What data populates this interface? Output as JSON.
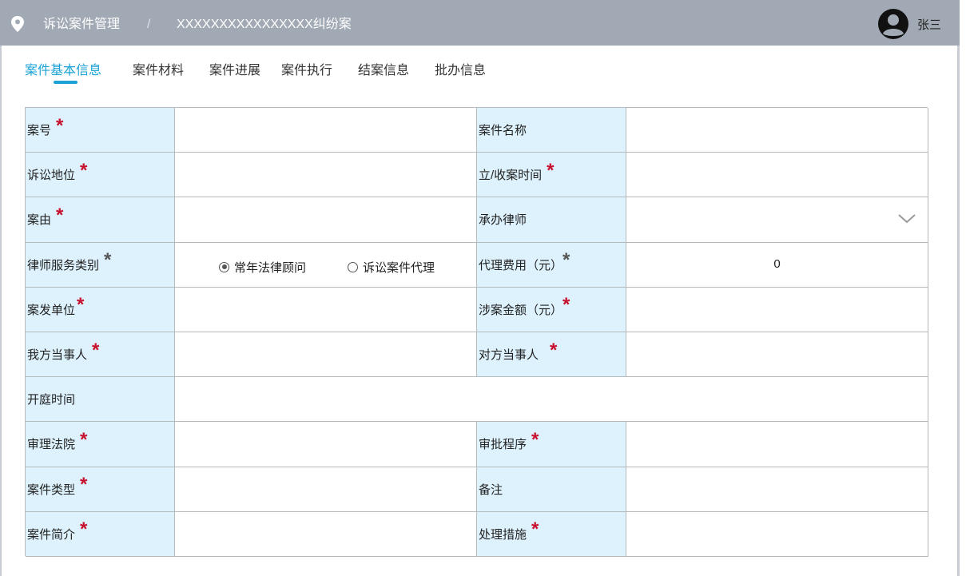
{
  "header": {
    "breadcrumb_root": "诉讼案件管理",
    "breadcrumb_sep": "/",
    "breadcrumb_case": "XXXXXXXXXXXXXXXX纠纷案",
    "user_name": "张三"
  },
  "tabs": [
    {
      "label": "案件基本信息",
      "active": true
    },
    {
      "label": "案件材料",
      "active": false
    },
    {
      "label": "案件进展",
      "active": false
    },
    {
      "label": "案件执行",
      "active": false
    },
    {
      "label": "结案信息",
      "active": false
    },
    {
      "label": "批办信息",
      "active": false
    }
  ],
  "form": {
    "case_no": {
      "label": "案号",
      "star": "*",
      "value": ""
    },
    "case_name": {
      "label": "案件名称",
      "value": ""
    },
    "litigation_status": {
      "label": "诉讼地位",
      "star": "*",
      "value": ""
    },
    "filing_time": {
      "label": "立/收案时间",
      "star": "*",
      "value": ""
    },
    "cause": {
      "label": "案由",
      "star": "*",
      "value": ""
    },
    "lawyer": {
      "label": "承办律师",
      "value": ""
    },
    "service_type": {
      "label": "律师服务类别",
      "star": "*",
      "options": [
        {
          "label": "常年法律顾问",
          "checked": true
        },
        {
          "label": "诉讼案件代理",
          "checked": false
        }
      ]
    },
    "agency_fee": {
      "label": "代理费用（元）",
      "star": "*",
      "value": "0"
    },
    "origin_unit": {
      "label": "案发单位",
      "star": "*",
      "value": ""
    },
    "amount_involved": {
      "label": "涉案金额（元）",
      "star": "*",
      "value": ""
    },
    "our_party": {
      "label": "我方当事人",
      "star": "*",
      "value": ""
    },
    "opposing_party": {
      "label": "对方当事人",
      "star": "*",
      "value": ""
    },
    "hearing_time": {
      "label": "开庭时间",
      "value": ""
    },
    "court": {
      "label": "审理法院",
      "star": "*",
      "value": ""
    },
    "approval_procedure": {
      "label": "审批程序",
      "star": "*",
      "value": ""
    },
    "case_type": {
      "label": "案件类型",
      "star": "*",
      "value": ""
    },
    "remark": {
      "label": "备注",
      "value": ""
    },
    "case_summary": {
      "label": "案件简介",
      "star": "*",
      "value": ""
    },
    "measures": {
      "label": "处理措施",
      "star": "*",
      "value": ""
    }
  },
  "colors": {
    "header_bg": "#a1aab4",
    "accent": "#1aa2d6",
    "label_bg": "#ddf2fc",
    "required_star": "#c8102e",
    "grid_border": "#b6b9bd"
  }
}
